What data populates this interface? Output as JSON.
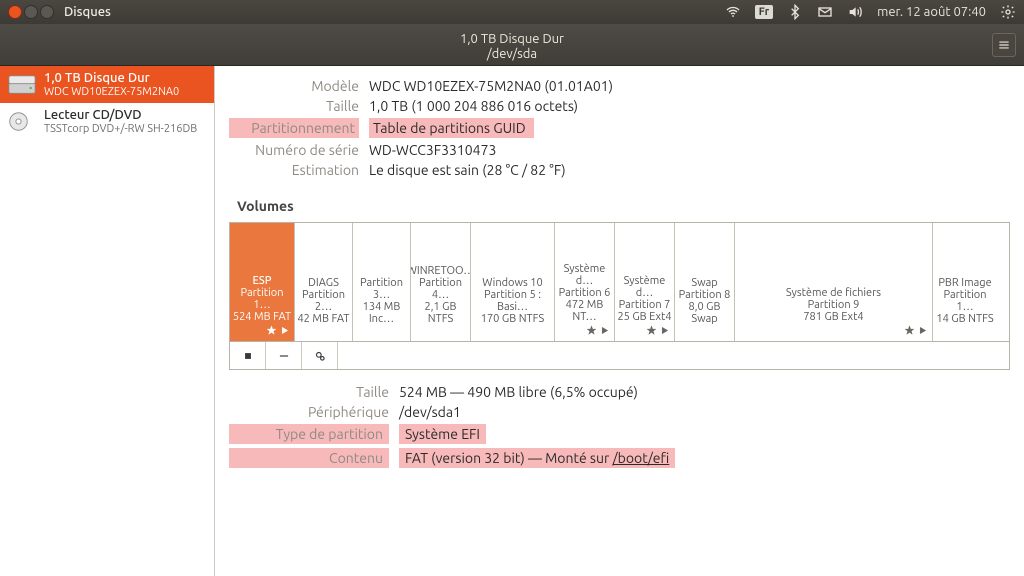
{
  "menubar": {
    "app_name": "Disques",
    "lang_indicator": "Fr",
    "datetime": "mer. 12 août 07:40"
  },
  "header": {
    "title": "1,0 TB Disque Dur",
    "subtitle": "/dev/sda"
  },
  "sidebar": {
    "drives": [
      {
        "title": "1,0 TB Disque Dur",
        "subtitle": "WDC WD10EZEX-75M2NA0",
        "icon": "hdd-icon",
        "active": true
      },
      {
        "title": "Lecteur CD/DVD",
        "subtitle": "TSSTcorp DVD+/-RW SH-216DB",
        "icon": "optical-icon",
        "active": false
      }
    ]
  },
  "props": {
    "rows": [
      {
        "label": "Modèle",
        "value": "WDC WD10EZEX-75M2NA0 (01.01A01)",
        "hl": false
      },
      {
        "label": "Taille",
        "value": "1,0 TB (1 000 204 886 016 octets)",
        "hl": false
      },
      {
        "label": "Partitionnement",
        "value": "Table de partitions GUID",
        "hl": true
      },
      {
        "label": "Numéro de série",
        "value": "WD-WCC3F3310473",
        "hl": false
      },
      {
        "label": "Estimation",
        "value": "Le disque est sain (28 °C / 82 °F)",
        "hl": false
      }
    ]
  },
  "volumes_label": "Volumes",
  "partitions": [
    {
      "name": "ESP",
      "num": "Partition 1…",
      "size": "524 MB FAT",
      "w": 65,
      "selected": true,
      "star": true,
      "play": true
    },
    {
      "name": "DIAGS",
      "num": "Partition 2…",
      "size": "42 MB FAT",
      "w": 58,
      "selected": false,
      "star": false,
      "play": false
    },
    {
      "name": "",
      "num": "Partition 3…",
      "size": "134 MB Inc…",
      "w": 58,
      "selected": false,
      "star": false,
      "play": false
    },
    {
      "name": "WINRETOO…",
      "num": "Partition 4…",
      "size": "2,1 GB NTFS",
      "w": 60,
      "selected": false,
      "star": false,
      "play": false
    },
    {
      "name": "Windows 10",
      "num": "Partition 5 : Basi…",
      "size": "170 GB NTFS",
      "w": 84,
      "selected": false,
      "star": false,
      "play": false
    },
    {
      "name": "Système d…",
      "num": "Partition 6",
      "size": "472 MB NT…",
      "w": 60,
      "selected": false,
      "star": true,
      "play": true
    },
    {
      "name": "Système d…",
      "num": "Partition 7",
      "size": "25 GB Ext4",
      "w": 60,
      "selected": false,
      "star": true,
      "play": true
    },
    {
      "name": "Swap",
      "num": "Partition 8",
      "size": "8,0 GB Swap",
      "w": 60,
      "selected": false,
      "star": false,
      "play": false
    },
    {
      "name": "Système de fichiers",
      "num": "Partition 9",
      "size": "781 GB Ext4",
      "w": 198,
      "selected": false,
      "star": true,
      "play": true
    },
    {
      "name": "PBR Image",
      "num": "Partition 1…",
      "size": "14 GB NTFS",
      "w": 64,
      "selected": false,
      "star": false,
      "play": false
    }
  ],
  "details": {
    "rows": [
      {
        "label": "Taille",
        "value": "524 MB — 490 MB libre (6,5% occupé)",
        "hl": false
      },
      {
        "label": "Périphérique",
        "value": "/dev/sda1",
        "hl": false
      },
      {
        "label": "Type de partition",
        "value": "Système EFI",
        "hl": true
      },
      {
        "label": "Contenu",
        "value_prefix": "FAT (version 32 bit) — Monté sur ",
        "mount": "/boot/efi",
        "hl": true
      }
    ]
  }
}
